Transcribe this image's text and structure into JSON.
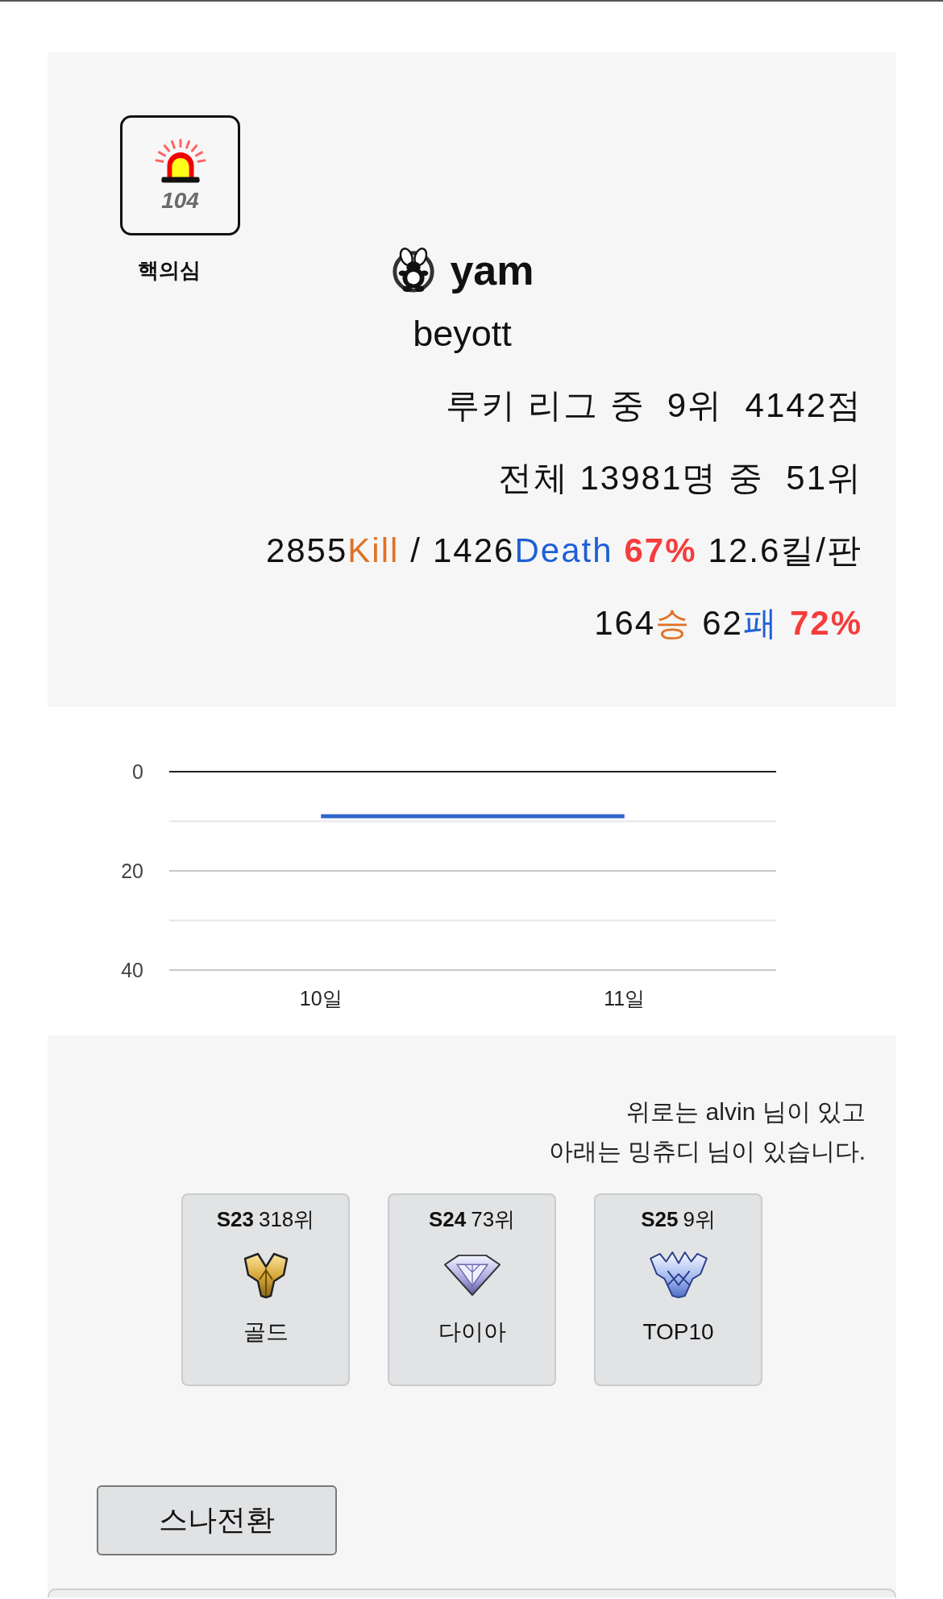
{
  "badge": {
    "number": "104",
    "title": "핵의심"
  },
  "player": {
    "clan": "yam",
    "name": "beyott"
  },
  "stats": {
    "league": "루키 리그 중  9위  4142점",
    "overall": "전체 13981명 중  51위",
    "kd": {
      "kills": {
        "value": "2855",
        "label": "Kill"
      },
      "separator": "/",
      "deaths": {
        "value": "1426",
        "label": "Death"
      },
      "rate": "67%",
      "per_game": "12.6킬/판"
    },
    "record": {
      "wins": {
        "value": "164",
        "label": "승"
      },
      "losses": {
        "value": "62",
        "label": "패"
      },
      "rate": "72%"
    }
  },
  "chart": {
    "chart_data": {
      "type": "line",
      "categories": [
        "10일",
        "11일"
      ],
      "series": [
        {
          "color": "#3366cc",
          "values": [
            9,
            9
          ]
        }
      ],
      "ylim": [
        40,
        0
      ],
      "yticks": [
        0,
        20,
        40
      ],
      "ref_lines": [
        {
          "axis": "y",
          "value": 10
        },
        {
          "axis": "y",
          "value": 30
        }
      ]
    }
  },
  "neighbors": {
    "lines": [
      "위로는 alvin 님이 있고",
      "아래는 밍츄디 님이 있습니다."
    ]
  },
  "seasons": [
    {
      "season": "S23",
      "rank": "318위",
      "tier": "골드",
      "kind": "gold"
    },
    {
      "season": "S24",
      "rank": "73위",
      "tier": "다이아",
      "kind": "diamond"
    },
    {
      "season": "S25",
      "rank": "9위",
      "tier": "TOP10",
      "kind": "top"
    }
  ],
  "switch_button": {
    "label": "스나전환"
  }
}
